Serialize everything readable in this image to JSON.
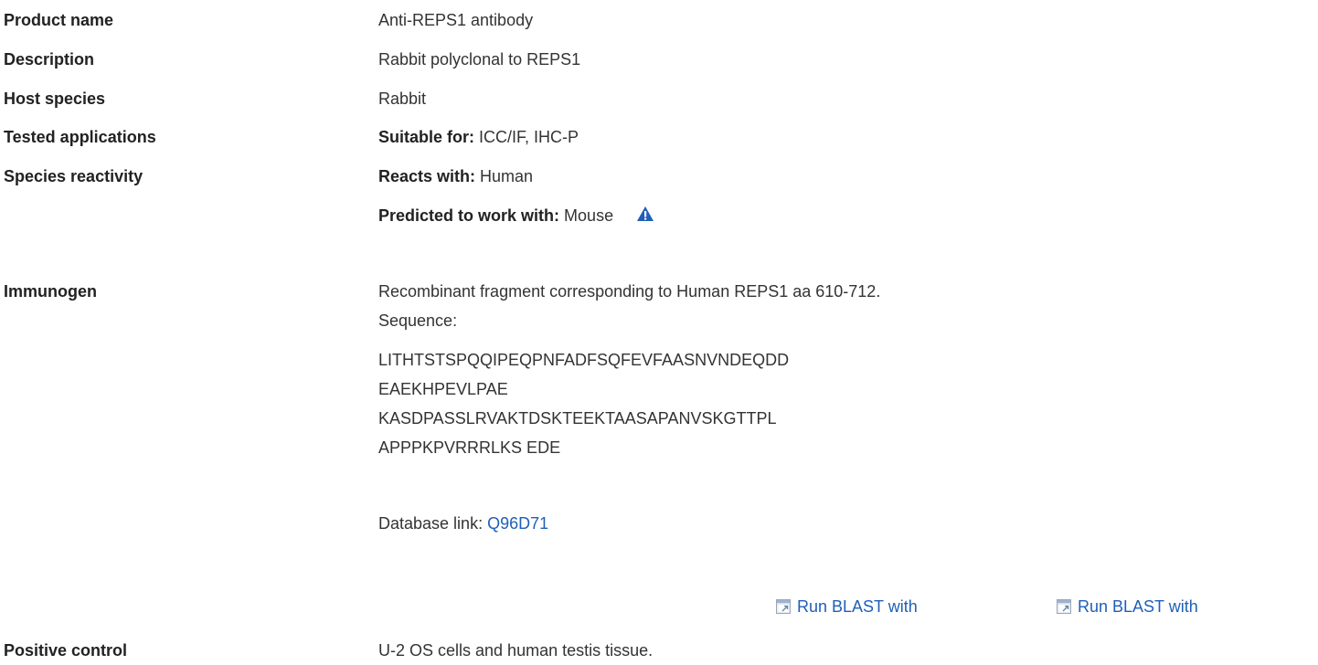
{
  "rows": {
    "product_name": {
      "label": "Product name",
      "value": "Anti-REPS1 antibody"
    },
    "description": {
      "label": "Description",
      "value": "Rabbit polyclonal to REPS1"
    },
    "host_species": {
      "label": "Host species",
      "value": "Rabbit"
    },
    "tested_applications": {
      "label": "Tested applications",
      "prefix": "Suitable for:",
      "value": "ICC/IF, IHC-P"
    },
    "species_reactivity": {
      "label": "Species reactivity",
      "reacts_prefix": "Reacts with:",
      "reacts_value": "Human",
      "predicted_prefix": "Predicted to work with:",
      "predicted_value": "Mouse",
      "predicted_icon": "warning-icon"
    },
    "immunogen": {
      "label": "Immunogen",
      "description": "Recombinant fragment corresponding to Human REPS1 aa 610-712.",
      "sequence_label": "Sequence:",
      "sequence_lines": [
        "LITHTSTSPQQIPEQPNFADFSQFEVFAASNVNDEQDD",
        "EAEKHPEVLPAE",
        "KASDPASSLRVAKTDSKTEEKTAASAPANVSKGTTPL",
        "APPPKPVRRRLKS EDE"
      ],
      "database_prefix": "Database link:",
      "database_link": "Q96D71",
      "blast_buttons": [
        "Run BLAST with",
        "Run BLAST with"
      ],
      "blast_icon": "external-window-icon"
    },
    "positive_control": {
      "label": "Positive control",
      "value": "U-2 OS cells and human testis tissue."
    }
  },
  "colors": {
    "link": "#1f5fb8",
    "warning_icon": "#1f5fb8"
  }
}
